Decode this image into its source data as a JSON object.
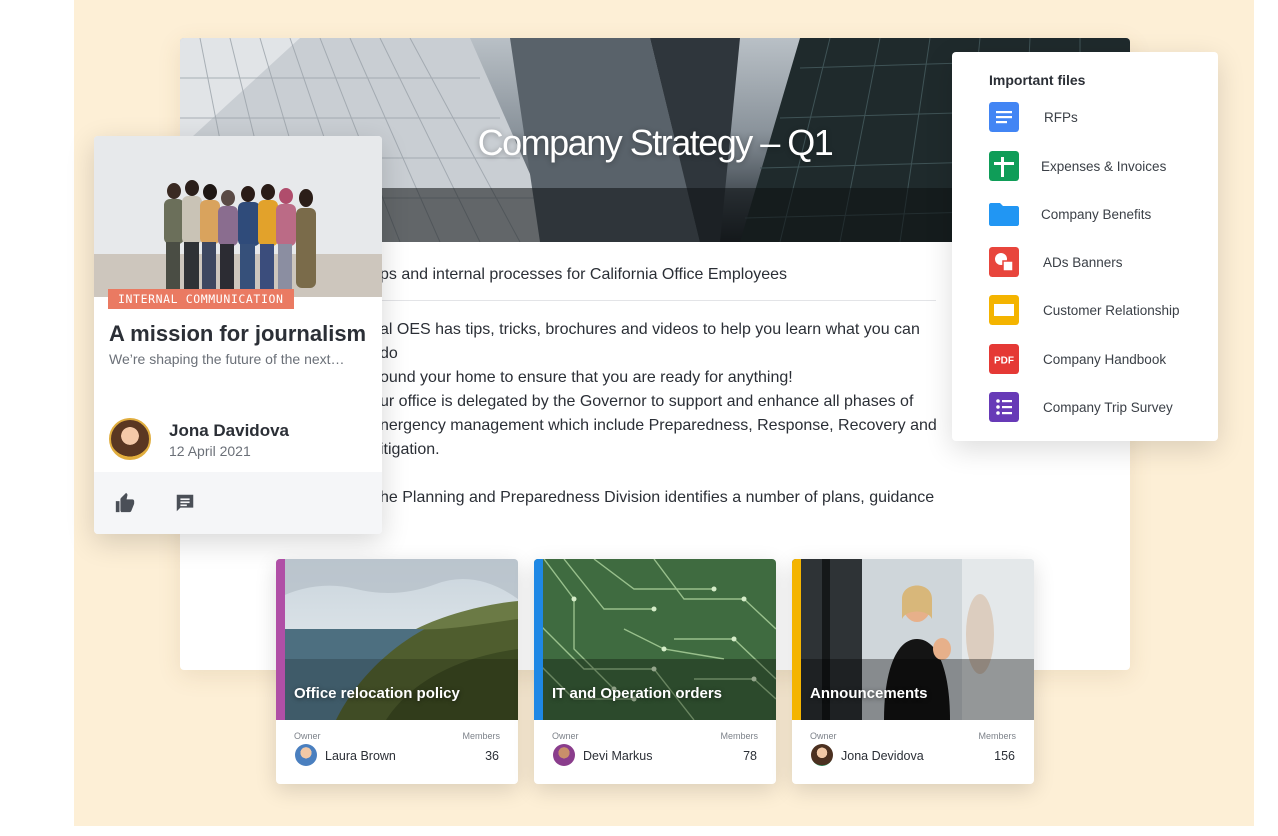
{
  "article": {
    "title": "Company Strategy – Q1",
    "subtitle": "ps and internal processes for California Office Employees",
    "paragraphs": [
      [
        "al OES has tips, tricks, brochures and videos to help you learn what you can do",
        "ound your home to ensure that you are ready for anything!"
      ],
      [
        "ur office is delegated by the Governor to support and enhance all phases of",
        "nergency management which include Preparedness, Response, Recovery and",
        "itigation."
      ],
      [
        "he Planning and Preparedness Division identifies a number of plans, guidance"
      ]
    ]
  },
  "news_card": {
    "tag": "INTERNAL COMMUNICATION",
    "title": "A mission for journalism",
    "excerpt": "We’re shaping the future of the next…",
    "author_name": "Jona Davidova",
    "date": "12 April 2021",
    "like_icon": "thumbs-up-icon",
    "comment_icon": "comment-icon"
  },
  "files_panel": {
    "title": "Important files",
    "files": [
      {
        "label": "RFPs",
        "icon": "google-docs-icon",
        "color": "#4285f4"
      },
      {
        "label": "Expenses & Invoices",
        "icon": "google-sheets-icon",
        "color": "#0f9d58"
      },
      {
        "label": "Company Benefits",
        "icon": "folder-icon",
        "color": "#2196f3"
      },
      {
        "label": "ADs Banners",
        "icon": "google-drawings-icon",
        "color": "#e8453c"
      },
      {
        "label": "Customer Relationship",
        "icon": "google-slides-icon",
        "color": "#f4b400"
      },
      {
        "label": "Company Handbook",
        "icon": "pdf-icon",
        "color": "#e53935",
        "badge": "PDF"
      },
      {
        "label": "Company Trip Survey",
        "icon": "google-forms-icon",
        "color": "#673ab7"
      }
    ]
  },
  "channels": [
    {
      "title": "Office relocation policy",
      "owner_caption": "Owner",
      "owner": "Laura Brown",
      "members_caption": "Members",
      "members": "36",
      "accent": "#b04fa6"
    },
    {
      "title": "IT and Operation orders",
      "owner_caption": "Owner",
      "owner": "Devi Markus",
      "members_caption": "Members",
      "members": "78",
      "accent": "#1e88e5"
    },
    {
      "title": "Announcements",
      "owner_caption": "Owner",
      "owner": "Jona Devidova",
      "members_caption": "Members",
      "members": "156",
      "accent": "#f4b400"
    }
  ],
  "colors": {
    "background_panel": "#fdefd6",
    "tag": "#ea7a62",
    "text": "#2b2f36",
    "muted": "#6b7078"
  }
}
